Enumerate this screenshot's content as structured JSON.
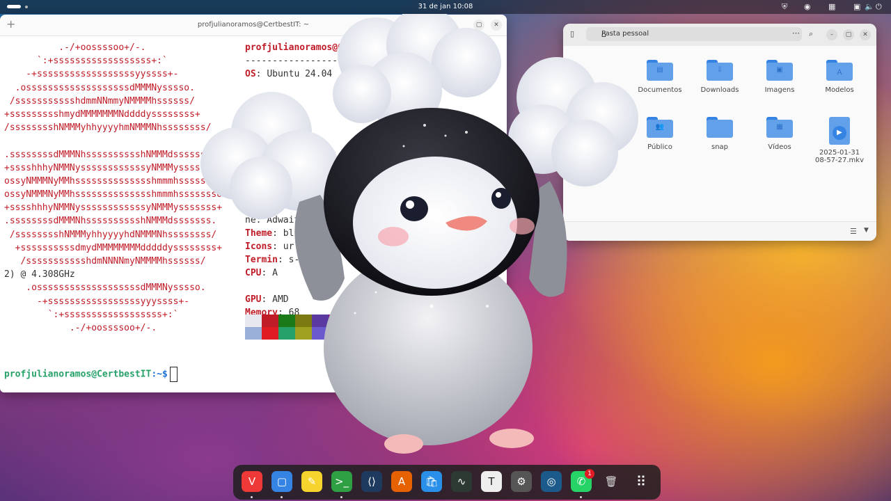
{
  "topbar": {
    "clock": "31 de jan  10:08"
  },
  "terminal": {
    "title": "profjulianoramos@CertbestIT: ~",
    "logo_lines": [
      "          .-/+oossssoo+/-.",
      "      `:+ssssssssssssssssss+:`",
      "    -+ssssssssssssssssssyyssss+-",
      "  .osssssssssssssssssssdMMMNysssso.",
      " /ssssssssssshdmmNNmmyNMMMMhssssss/",
      "+ssssssssshmydMMMMMMMNddddyssssssss+",
      "/sssssssshNMMMyhhyyyyhmNMMMNhssssssss/",
      "",
      ".ssssssssdMMMNhsssssssssshNMMMdsssssss.",
      "+sssshhhyNMMNyssssssssssssyNMMMysssssss+",
      "ossyNMMMNyMMhsssssssssssssshmmmhssssssso",
      "ossyNMMMNyMMhsssssssssssssshmmmhssssssso",
      "+sssshhhyNMMNyssssssssssssyNMMMysssssss+",
      ".ssssssssdMMMNhsssssssssshNMMMdsssssss.",
      " /sssssssshNMMMyhhyyyyhdNMMMNhssssssss/",
      "  +ssssssssssdmydMMMMMMMMdddddyssssssss+",
      "   /ssssssssssshdmNNNNmyNMMMMhssssss/",
      "2) @ 4.308GHz",
      "    .osssssssssssssssssssdMMMNysssso.",
      "      -+sssssssssssssssssyyyssss+-",
      "        `:+ssssssssssssssssss+:`",
      "            .-/+oossssoo+/-."
    ],
    "info": {
      "header": "profjulianoramos@Cert",
      "separator": "--------------------",
      "os_label": "OS",
      "os_value": "Ubuntu 24.04",
      "theme_label": "Theme",
      "theme_value": "blue",
      "icons_label": "Icons",
      "icons_value": "ur [",
      "terminal_label": "Termin",
      "terminal_value": "s-",
      "cpu_label": "CPU",
      "cpu_value": "A",
      "wm_theme_partial": "ne: Adwaita",
      "gpu_label": "GPU",
      "gpu_value": "AMD",
      "memory_label": "Memory",
      "memory_value": "68"
    },
    "swatch_colors": [
      "#e8e8f0",
      "#c01c28",
      "#1a7a1a",
      "#7a7a10",
      "#5a3aa0",
      "#8a1a8a",
      "#9ab0d8",
      "#e01b24",
      "#26a269",
      "#a0a020",
      "#6a5acd",
      "#c061cb"
    ],
    "prompt_user": "profjulianoramos@CertbestIT",
    "prompt_path": ":~$"
  },
  "files": {
    "location": "Pasta pessoal",
    "items": [
      {
        "label": "Documentos",
        "glyph": "▤"
      },
      {
        "label": "Downloads",
        "glyph": "⇩"
      },
      {
        "label": "Imagens",
        "glyph": "▣"
      },
      {
        "label": "Modelos",
        "glyph": "Ａ"
      },
      {
        "label": "Público",
        "glyph": "👥"
      },
      {
        "label": "snap",
        "glyph": ""
      },
      {
        "label": "Vídeos",
        "glyph": "▦"
      },
      {
        "label": "2025-01-31\n08-57-27.mkv",
        "glyph": "▶"
      }
    ]
  },
  "dock": {
    "apps": [
      {
        "name": "vivaldi",
        "glyph": "V",
        "color": "#ef3939"
      },
      {
        "name": "files",
        "glyph": "▢",
        "color": "#3584e4"
      },
      {
        "name": "text-editor",
        "glyph": "✎",
        "color": "#f6d32d"
      },
      {
        "name": "terminal",
        "glyph": ">_",
        "color": "#2ea043"
      },
      {
        "name": "vscode",
        "glyph": "⟨⟩",
        "color": "#1e3a5f"
      },
      {
        "name": "app-center",
        "glyph": "A",
        "color": "#e66100"
      },
      {
        "name": "store",
        "glyph": "🛍",
        "color": "#2a8fe8"
      },
      {
        "name": "system-monitor",
        "glyph": "∿",
        "color": "#2d3a34"
      },
      {
        "name": "typora",
        "glyph": "T",
        "color": "#eeeeee"
      },
      {
        "name": "settings",
        "glyph": "⚙",
        "color": "#555555"
      },
      {
        "name": "steam",
        "glyph": "◎",
        "color": "#1b5a8a"
      },
      {
        "name": "whatsapp",
        "glyph": "✆",
        "color": "#25d366"
      },
      {
        "name": "trash",
        "glyph": "🗑",
        "color": "#cccccc"
      },
      {
        "name": "app-grid",
        "glyph": "⠿",
        "color": "#2a2a2a"
      }
    ],
    "whatsapp_badge": "1"
  }
}
